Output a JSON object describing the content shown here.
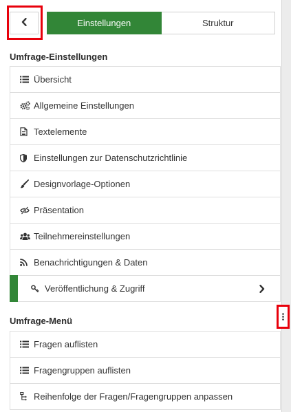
{
  "header": {
    "back_icon": "chevron-left-icon",
    "tabs": [
      {
        "label": "Einstellungen",
        "active": true
      },
      {
        "label": "Struktur",
        "active": false
      }
    ]
  },
  "survey_settings": {
    "title": "Umfrage-Einstellungen",
    "items": [
      {
        "label": "Übersicht",
        "icon": "list-icon"
      },
      {
        "label": "Allgemeine Einstellungen",
        "icon": "gears-icon"
      },
      {
        "label": "Textelemente",
        "icon": "file-text-icon"
      },
      {
        "label": "Einstellungen zur Datenschutzrichtlinie",
        "icon": "shield-icon"
      },
      {
        "label": "Designvorlage-Optionen",
        "icon": "paintbrush-icon"
      },
      {
        "label": "Präsentation",
        "icon": "eye-slash-icon"
      },
      {
        "label": "Teilnehmereinstellungen",
        "icon": "users-icon"
      },
      {
        "label": "Benachrichtigungen & Daten",
        "icon": "rss-icon"
      },
      {
        "label": "Veröffentlichung & Zugriff",
        "icon": "key-icon",
        "active": true
      }
    ]
  },
  "survey_menu": {
    "title": "Umfrage-Menü",
    "items": [
      {
        "label": "Fragen auflisten",
        "icon": "list-icon"
      },
      {
        "label": "Fragengruppen auflisten",
        "icon": "list-icon"
      },
      {
        "label": "Reihenfolge der Fragen/Fragengruppen anpassen",
        "icon": "sitemap-icon"
      }
    ]
  },
  "colors": {
    "accent": "#328637",
    "highlight": "#e8000b"
  }
}
